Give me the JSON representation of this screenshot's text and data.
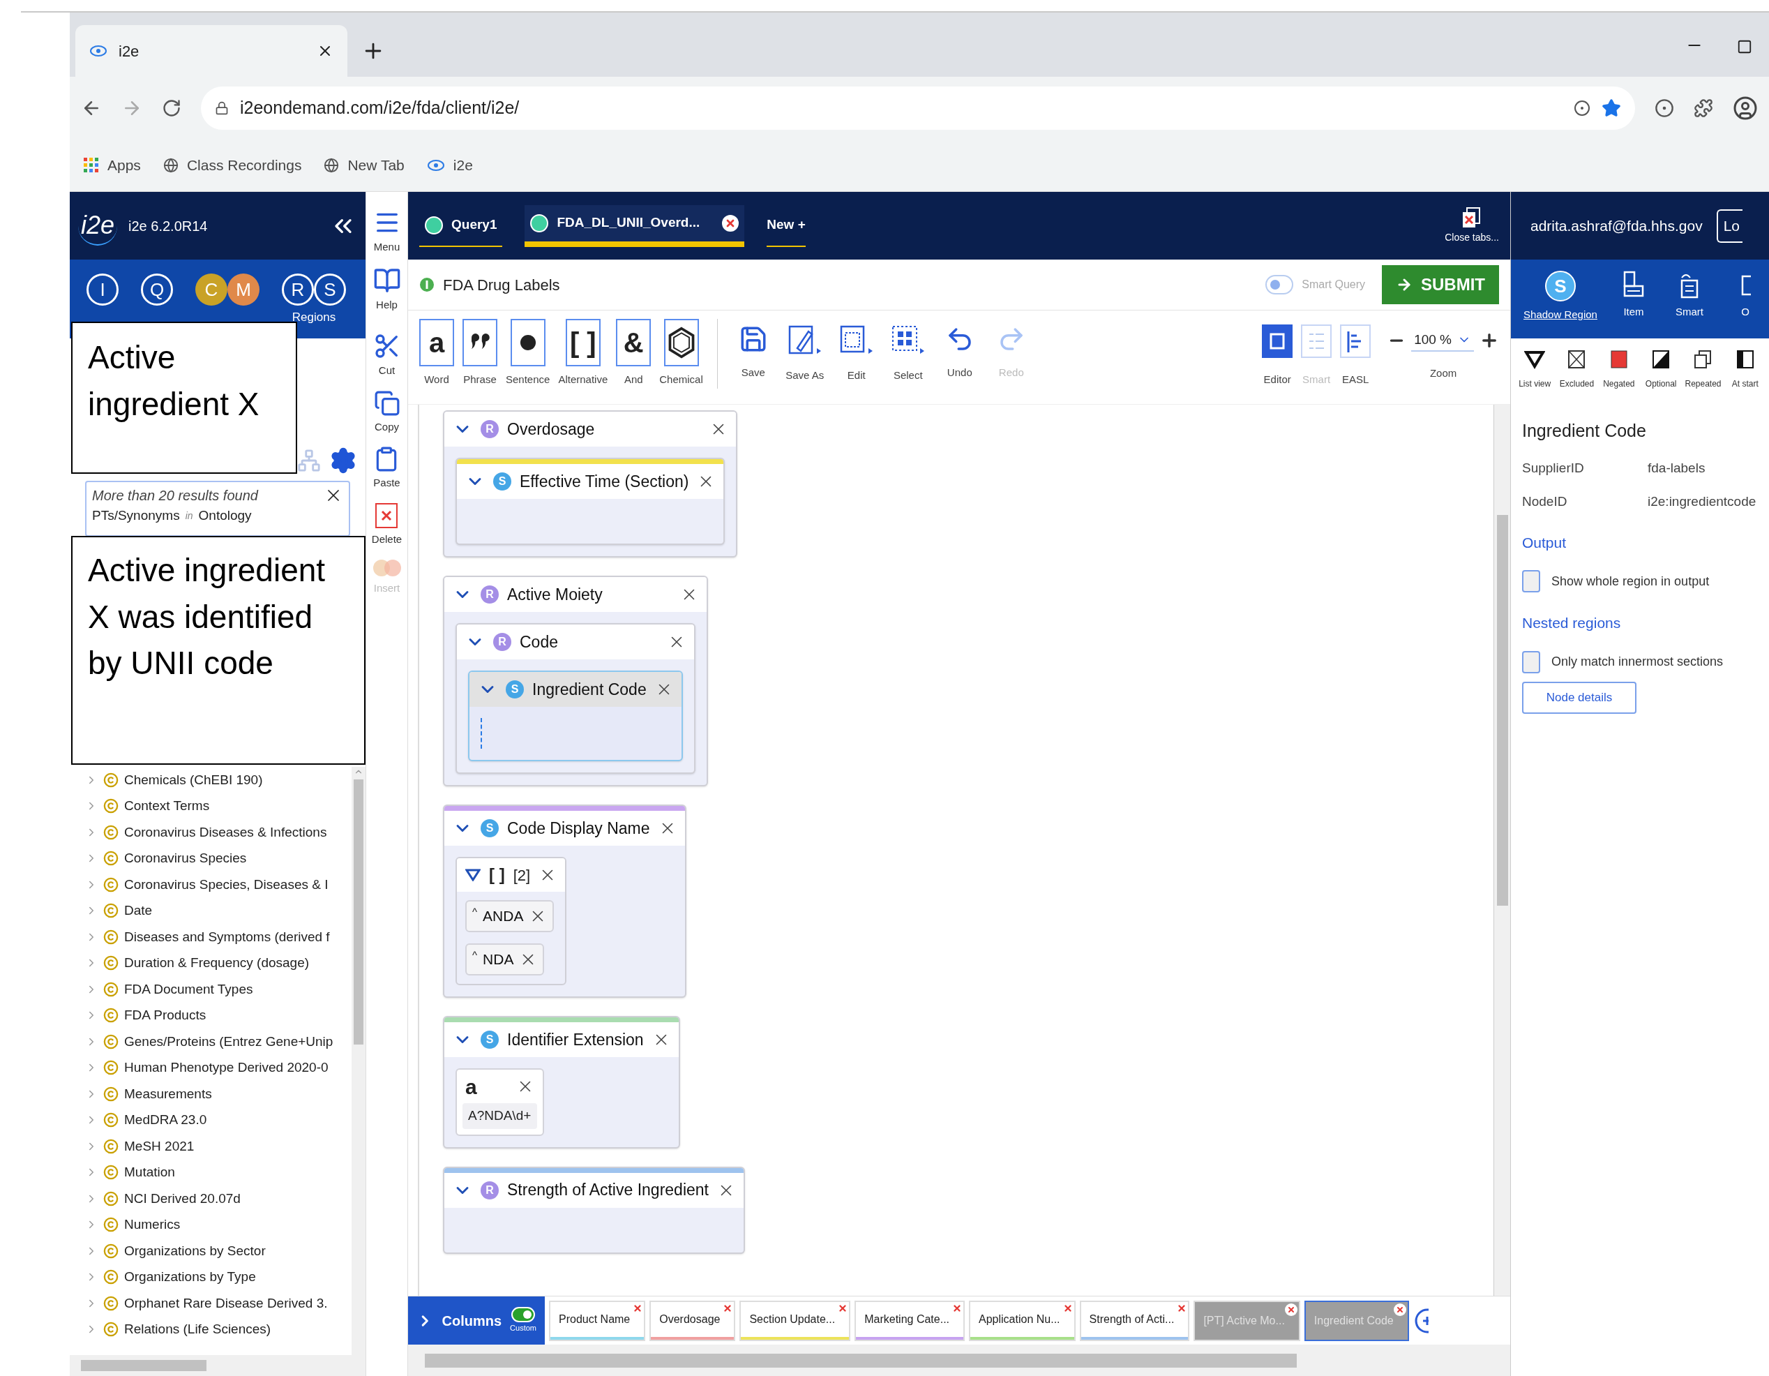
{
  "browser": {
    "tab": {
      "title": "i2e"
    },
    "url": "i2eondemand.com/i2e/fda/client/i2e/",
    "bookmarks": [
      {
        "label": "Apps",
        "kind": "apps"
      },
      {
        "label": "Class Recordings",
        "kind": "globe"
      },
      {
        "label": "New Tab",
        "kind": "globe"
      },
      {
        "label": "i2e",
        "kind": "logo"
      }
    ]
  },
  "app": {
    "logo": "i2e",
    "version": "i2e 6.2.0R14"
  },
  "nav_icons": [
    {
      "letters": [
        {
          "text": "I"
        }
      ]
    },
    {
      "letters": [
        {
          "text": "Q"
        }
      ]
    },
    {
      "letters": [
        {
          "text": "C",
          "color": "#c9a227"
        },
        {
          "text": "M",
          "color": "#e0894a"
        }
      ]
    },
    {
      "letters": [
        {
          "text": "R"
        },
        {
          "text": "S"
        }
      ],
      "label": "Regions"
    }
  ],
  "search_result": {
    "message": "More than 20 results found",
    "source": "PTs/Synonyms",
    "connector": "in",
    "target": "Ontology"
  },
  "ontologies": [
    "Chemicals (ChEBI 190)",
    "Context Terms",
    "Coronavirus Diseases & Infections",
    "Coronavirus Species",
    "Coronavirus Species, Diseases & I",
    "Date",
    "Diseases and Symptoms (derived f",
    "Duration & Frequency (dosage)",
    "FDA Document Types",
    "FDA Products",
    "Genes/Proteins (Entrez Gene+Unip",
    "Human Phenotype Derived 2020-0",
    "Measurements",
    "MedDRA 23.0",
    "MeSH 2021",
    "Mutation",
    "NCI Derived 20.07d",
    "Numerics",
    "Organizations by Sector",
    "Organizations by Type",
    "Orphanet Rare Disease Derived 3.",
    "Relations (Life Sciences)"
  ],
  "callouts": [
    "Active ingredient X",
    "Active ingredient X was identified by UNII code"
  ],
  "side_tools": [
    {
      "kind": "menu",
      "label": "Menu",
      "disabled": false
    },
    {
      "kind": "help",
      "label": "Help",
      "disabled": false
    },
    {
      "kind": "cut",
      "label": "Cut",
      "disabled": false
    },
    {
      "kind": "copy",
      "label": "Copy",
      "disabled": false
    },
    {
      "kind": "paste",
      "label": "Paste",
      "disabled": false
    },
    {
      "kind": "delete",
      "label": "Delete",
      "disabled": false
    },
    {
      "kind": "insert",
      "label": "Insert",
      "disabled": true
    }
  ],
  "query_tabs": [
    {
      "label": "Query1",
      "selected": false,
      "closable": false
    },
    {
      "label": "FDA_DL_UNII_Overd...",
      "selected": true,
      "closable": true
    }
  ],
  "new_tab": "New +",
  "close_tabs": "Close tabs...",
  "user": {
    "email": "adrita.ashraf@fda.hhs.gov",
    "logout": "Lo"
  },
  "query": {
    "source": "FDA Drug Labels",
    "smart_query": {
      "label": "Smart Query",
      "on": false
    },
    "submit": "SUBMIT"
  },
  "toolbar": {
    "elements": [
      {
        "kind": "word",
        "glyph": "a",
        "label": "Word"
      },
      {
        "kind": "phrase",
        "label": "Phrase"
      },
      {
        "kind": "sentence",
        "label": "Sentence"
      },
      {
        "kind": "alternative",
        "glyph": "[ ]",
        "label": "Alternative"
      },
      {
        "kind": "and",
        "glyph": "&",
        "label": "And"
      },
      {
        "kind": "chemical",
        "label": "Chemical"
      }
    ],
    "actions": [
      {
        "kind": "save",
        "label": "Save",
        "disabled": false
      },
      {
        "kind": "save_as",
        "label": "Save As",
        "disabled": false
      },
      {
        "kind": "edit",
        "label": "Edit",
        "disabled": false
      },
      {
        "kind": "select",
        "label": "Select",
        "disabled": false
      },
      {
        "kind": "undo",
        "label": "Undo",
        "disabled": false
      },
      {
        "kind": "redo",
        "label": "Redo",
        "disabled": true
      }
    ],
    "views": [
      {
        "kind": "editor",
        "label": "Editor",
        "selected": true,
        "disabled": false
      },
      {
        "kind": "smart",
        "label": "Smart",
        "selected": false,
        "disabled": true
      },
      {
        "kind": "easl",
        "label": "EASL",
        "selected": false,
        "disabled": false
      }
    ],
    "zoom": {
      "value": "100 %",
      "label": "Zoom"
    }
  },
  "nodes": [
    {
      "kind": "region",
      "title": "Overdosage",
      "badge": {
        "text": "R",
        "color": "#a48ee6"
      },
      "expanded": true,
      "selected": false,
      "children": [
        {
          "kind": "region",
          "title": "Effective Time (Section)",
          "badge": {
            "text": "S",
            "color": "#45a6e6"
          },
          "color": "#f2e14c",
          "expanded": true,
          "selected": false
        }
      ]
    },
    {
      "kind": "region",
      "title": "Active Moiety",
      "badge": {
        "text": "R",
        "color": "#a48ee6"
      },
      "expanded": true,
      "selected": false,
      "children": [
        {
          "kind": "region",
          "title": "Code",
          "badge": {
            "text": "R",
            "color": "#a48ee6"
          },
          "expanded": true,
          "selected": false,
          "children": [
            {
              "kind": "region",
              "title": "Ingredient Code",
              "badge": {
                "text": "S",
                "color": "#45a6e6"
              },
              "expanded": true,
              "selected": true
            }
          ]
        }
      ]
    },
    {
      "kind": "region",
      "title": "Code Display Name",
      "badge": {
        "text": "S",
        "color": "#45a6e6"
      },
      "color": "#c9a6f0",
      "expanded": true,
      "selected": false,
      "children": [
        {
          "kind": "alternative",
          "glyph": "[ ]",
          "title": "[2]",
          "expanded": true,
          "children": [
            {
              "kind": "term",
              "prefix": "^",
              "title": "ANDA"
            },
            {
              "kind": "term",
              "prefix": "^",
              "title": "NDA"
            }
          ]
        }
      ]
    },
    {
      "kind": "region",
      "title": "Identifier Extension",
      "badge": {
        "text": "S",
        "color": "#45a6e6"
      },
      "color": "#a9dcb0",
      "expanded": true,
      "selected": false,
      "children": [
        {
          "kind": "word",
          "glyph": "a",
          "value": "A?NDA\\d+"
        }
      ]
    },
    {
      "kind": "region",
      "title": "Strength of Active Ingredient",
      "badge": {
        "text": "R",
        "color": "#a48ee6"
      },
      "color": "#9ec3ee",
      "expanded": true,
      "selected": false
    }
  ],
  "columns": {
    "label": "Columns",
    "custom": {
      "label": "Custom",
      "on": true
    },
    "items": [
      {
        "label": "Product Name",
        "color": "#8fd8ec",
        "active": true,
        "selected": false
      },
      {
        "label": "Overdosage",
        "color": "#f0a0a0",
        "active": true,
        "selected": false
      },
      {
        "label": "Section Update...",
        "color": "#ece35a",
        "active": true,
        "selected": false
      },
      {
        "label": "Marketing Cate...",
        "color": "#c7a3f0",
        "active": true,
        "selected": false
      },
      {
        "label": "Application Nu...",
        "color": "#a8e08a",
        "active": true,
        "selected": false
      },
      {
        "label": "Strength of Acti...",
        "color": "#9ec3ee",
        "active": true,
        "selected": false
      },
      {
        "label": "[PT] Active Mo...",
        "active": false,
        "selected": false
      },
      {
        "label": "Ingredient Code",
        "active": false,
        "selected": true
      }
    ]
  },
  "region_tools": [
    {
      "kind": "shadow",
      "badge": "S",
      "label": "Shadow Region",
      "selected": true
    },
    {
      "kind": "item",
      "label": "Item",
      "selected": false
    },
    {
      "kind": "smart",
      "label": "Smart",
      "selected": false
    },
    {
      "kind": "other",
      "label": "O",
      "selected": false
    }
  ],
  "modifiers": [
    {
      "kind": "list_view",
      "label": "List view"
    },
    {
      "kind": "excluded",
      "label": "Excluded"
    },
    {
      "kind": "negated",
      "label": "Negated"
    },
    {
      "kind": "optional",
      "label": "Optional"
    },
    {
      "kind": "repeated",
      "label": "Repeated"
    },
    {
      "kind": "at_start",
      "label": "At start"
    }
  ],
  "details": {
    "title": "Ingredient Code",
    "properties": [
      {
        "name": "SupplierID",
        "value": "fda-labels"
      },
      {
        "name": "NodeID",
        "value": "i2e:ingredientcode"
      }
    ],
    "sections": [
      {
        "heading": "Output",
        "option": {
          "label": "Show whole region in output",
          "checked": false
        }
      },
      {
        "heading": "Nested regions",
        "option": {
          "label": "Only match innermost sections",
          "checked": false
        }
      }
    ],
    "button": "Node details"
  }
}
